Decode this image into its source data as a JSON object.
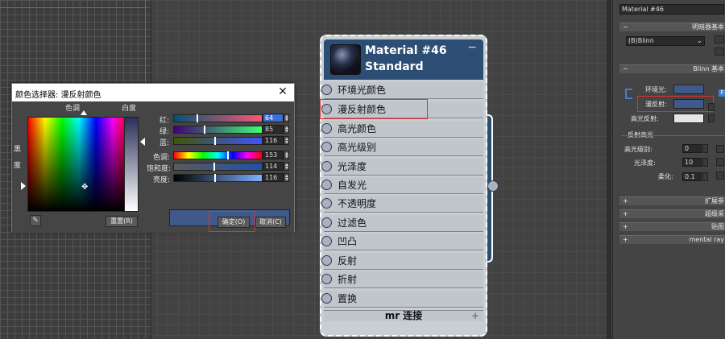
{
  "color_dialog": {
    "title": "颜色选择器: 漫反射颜色",
    "close_glyph": "✕",
    "hue_label": "色调",
    "whiteness_label": "白度",
    "black_label": "黑",
    "degree_label": "度",
    "sliders": [
      {
        "label": "红:",
        "value": "64",
        "selected": true
      },
      {
        "label": "绿:",
        "value": "85"
      },
      {
        "label": "蓝:",
        "value": "116"
      },
      {
        "label": "色调:",
        "value": "153"
      },
      {
        "label": "饱和度:",
        "value": "114"
      },
      {
        "label": "亮度:",
        "value": "116"
      }
    ],
    "reset_label": "重置(R)",
    "ok_label": "确定(O)",
    "cancel_label": "取消(C)",
    "current_color": "#3f5a8a"
  },
  "node": {
    "title": "Material #46",
    "subtitle": "Standard",
    "collapse_glyph": "−",
    "slots": [
      "环境光颜色",
      "漫反射颜色",
      "高光颜色",
      "高光级别",
      "光泽度",
      "自发光",
      "不透明度",
      "过滤色",
      "凹凸",
      "反射",
      "折射",
      "置换"
    ],
    "footer": "mr 连接",
    "footer_plus": "+"
  },
  "panel": {
    "material_name": "Material #46",
    "shader_rollup": "明暗器基本",
    "shader_value": "(B)Blinn",
    "blinn_rollup": "Blinn 基本",
    "ambient_label": "环境光:",
    "diffuse_label": "漫反射:",
    "specular_label": "高光反射:",
    "highlight_title": "反射高光",
    "spec_level_label": "高光级别:",
    "spec_level_value": "0",
    "gloss_label": "光泽度:",
    "gloss_value": "10",
    "soften_label": "柔化:",
    "soften_value": "0.1",
    "rollups": [
      {
        "sign": "+",
        "label": "扩展参"
      },
      {
        "sign": "+",
        "label": "超级采"
      },
      {
        "sign": "+",
        "label": "贴图"
      },
      {
        "sign": "+",
        "label": "mental ray"
      }
    ],
    "minus": "−",
    "plus": "+",
    "ambient_color": "#3f5a8a",
    "diffuse_color": "#3f5a8a",
    "specular_color": "#e5e5e5"
  }
}
